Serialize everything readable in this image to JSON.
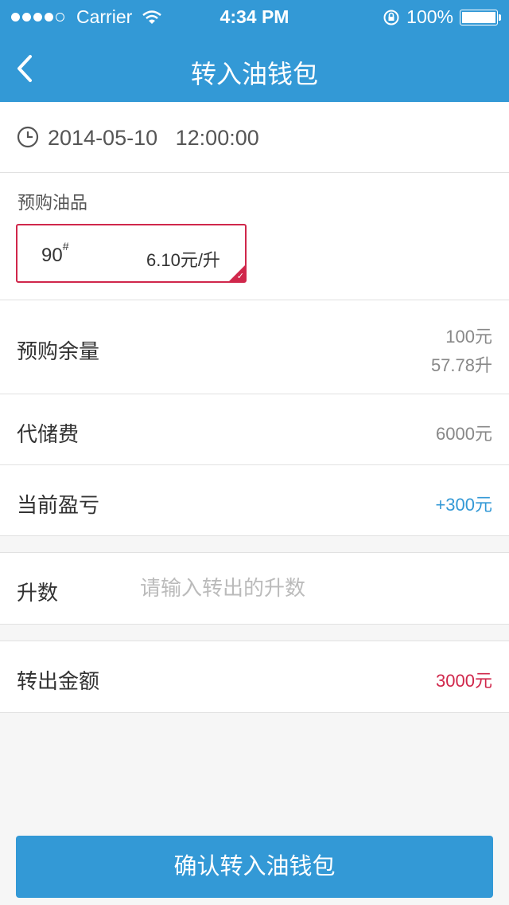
{
  "status_bar": {
    "carrier": "Carrier",
    "time": "4:34 PM",
    "battery": "100%"
  },
  "nav": {
    "title": "转入油钱包"
  },
  "datetime": {
    "date": "2014-05-10",
    "time": "12:00:00"
  },
  "product": {
    "section_label": "预购油品",
    "grade": "90",
    "grade_mark": "#",
    "price": "6.10元/升"
  },
  "remain": {
    "label": "预购余量",
    "amount": "100元",
    "liters": "57.78升"
  },
  "storage_fee": {
    "label": "代储费",
    "value": "6000元"
  },
  "profit_loss": {
    "label": "当前盈亏",
    "value": "+300元"
  },
  "liters_field": {
    "label": "升数",
    "placeholder": "请输入转出的升数",
    "value": ""
  },
  "transfer_amount": {
    "label": "转出金额",
    "value": "3000元"
  },
  "confirm_button": "确认转入油钱包",
  "colors": {
    "accent": "#3399d6",
    "highlight": "#d0274b",
    "background": "#f6f6f6"
  }
}
